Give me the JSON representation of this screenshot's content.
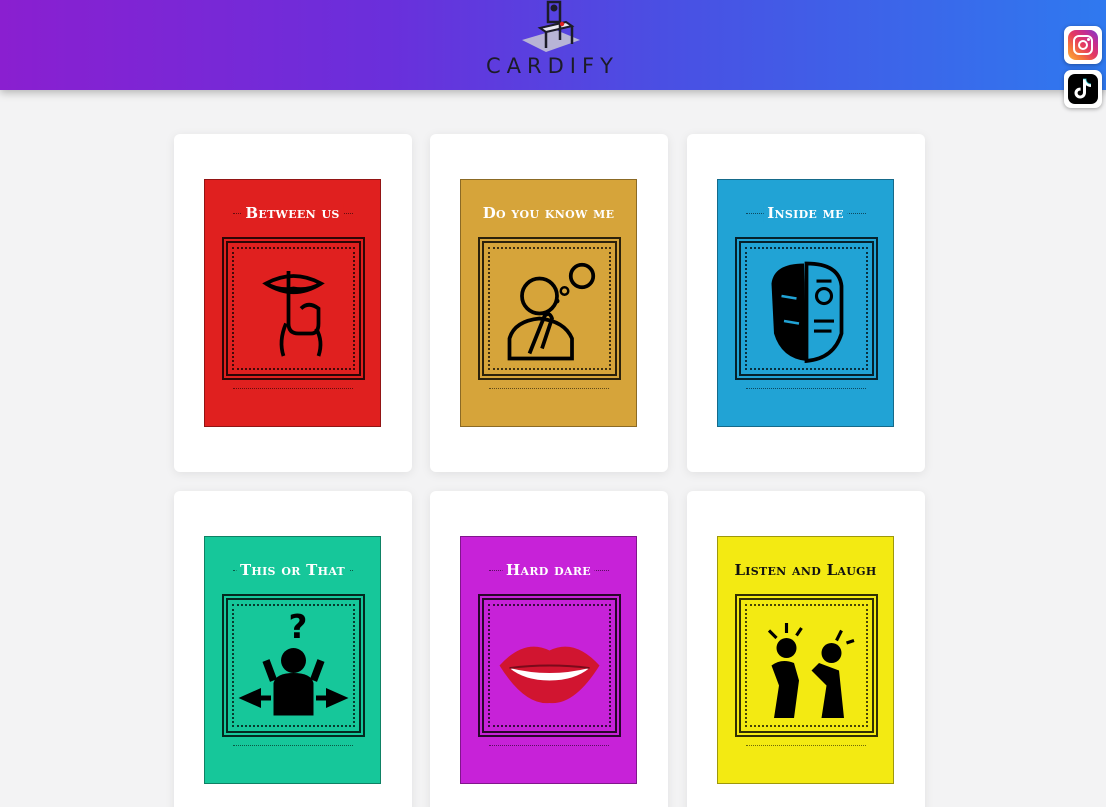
{
  "header": {
    "brand": "CARDIFY",
    "gradient_start": "#8a1fd0",
    "gradient_end": "#2f79ef"
  },
  "social": [
    {
      "name": "instagram",
      "icon": "instagram-icon"
    },
    {
      "name": "tiktok",
      "icon": "tiktok-icon"
    }
  ],
  "cards": [
    {
      "title": "Between us",
      "color": "#e0201f",
      "icon": "shush-lips-icon",
      "dark": false
    },
    {
      "title": "Do you know me",
      "color": "#d6a43a",
      "icon": "thinking-person-icon",
      "dark": false
    },
    {
      "title": "Inside me",
      "color": "#21a3d5",
      "icon": "face-robot-icon",
      "dark": false
    },
    {
      "title": "This or That",
      "color": "#16c79a",
      "icon": "confused-person-icon",
      "dark": false
    },
    {
      "title": "Hard dare",
      "color": "#c722d8",
      "icon": "biting-lips-icon",
      "dark": false
    },
    {
      "title": "Listen and Laugh",
      "color": "#f3ea12",
      "icon": "laughing-people-icon",
      "dark": true
    }
  ]
}
